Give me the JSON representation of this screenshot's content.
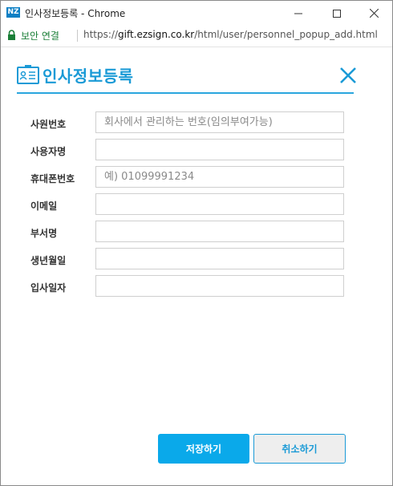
{
  "window": {
    "app_icon_text": "NZ",
    "title": "인사정보등록 - Chrome"
  },
  "addressbar": {
    "secure_label": "보안 연결",
    "url_scheme": "https://",
    "url_host": "gift.ezsign.co.kr",
    "url_path": "/html/user/personnel_popup_add.html"
  },
  "header": {
    "title": "인사정보등록"
  },
  "form": {
    "fields": [
      {
        "label": "사원번호",
        "value": "",
        "placeholder": "회사에서 관리하는 번호(임의부여가능)"
      },
      {
        "label": "사용자명",
        "value": "",
        "placeholder": ""
      },
      {
        "label": "휴대폰번호",
        "value": "",
        "placeholder": "예) 01099991234"
      },
      {
        "label": "이메일",
        "value": "",
        "placeholder": ""
      },
      {
        "label": "부서명",
        "value": "",
        "placeholder": ""
      },
      {
        "label": "생년월일",
        "value": "",
        "placeholder": ""
      },
      {
        "label": "입사일자",
        "value": "",
        "placeholder": ""
      }
    ]
  },
  "actions": {
    "save_label": "저장하기",
    "cancel_label": "취소하기"
  },
  "colors": {
    "accent": "#1a9ad6",
    "primary_button": "#0aa9ea",
    "secure_green": "#1a7f37"
  }
}
